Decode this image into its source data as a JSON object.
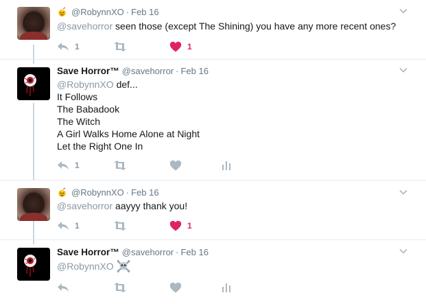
{
  "tweets": [
    {
      "name": "",
      "handle": "@RobynnXO",
      "sep": "·",
      "date": "Feb 16",
      "mention": "@savehorror",
      "lines": [
        " seen those (except The Shining) you have any more recent ones?"
      ],
      "reply_count": "1",
      "like_count": "1",
      "liked": true,
      "analytics": false
    },
    {
      "name": "Save Horror™",
      "handle": "@savehorror",
      "sep": "·",
      "date": "Feb 16",
      "mention": "@RobynnXO",
      "lines": [
        " def...",
        "It Follows",
        "The Babadook",
        "The Witch",
        "A Girl Walks Home Alone at Night",
        "Let the Right One In"
      ],
      "reply_count": "1",
      "like_count": "",
      "liked": false,
      "analytics": true
    },
    {
      "name": "",
      "handle": "@RobynnXO",
      "sep": "·",
      "date": "Feb 16",
      "mention": "@savehorror",
      "lines": [
        " aayyy thank you!"
      ],
      "reply_count": "1",
      "like_count": "1",
      "liked": true,
      "analytics": false
    },
    {
      "name": "Save Horror™",
      "handle": "@savehorror",
      "sep": "·",
      "date": "Feb 16",
      "mention": "@RobynnXO",
      "lines": [
        " "
      ],
      "reply_count": "",
      "like_count": "",
      "liked": false,
      "analytics": true
    }
  ],
  "icons": {
    "reply": "reply-icon",
    "retweet": "retweet-icon",
    "like": "heart-icon",
    "analytics": "analytics-icon",
    "more": "chevron-down-icon",
    "skull": "skull-crossbones-icon",
    "badge": "cocktail-emoji-icon"
  },
  "colors": {
    "liked": "#e0245e",
    "icon": "#aab8c2",
    "mention": "#8899a6",
    "meta": "#657786"
  }
}
